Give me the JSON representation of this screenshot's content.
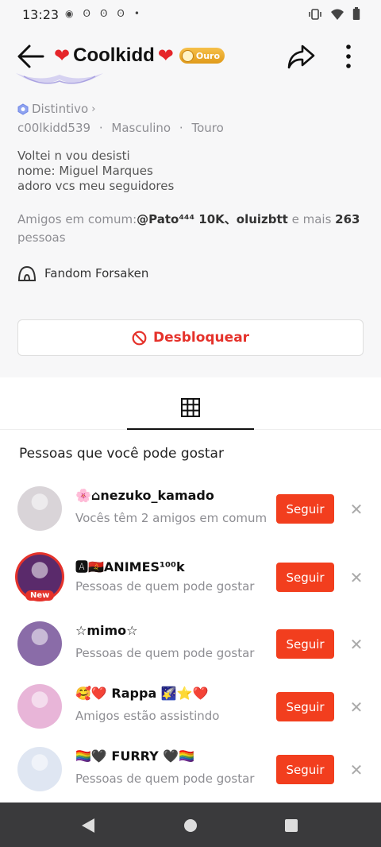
{
  "status": {
    "time": "13:23"
  },
  "header": {
    "title": "Coolkidd",
    "badge": "Ouro"
  },
  "profile": {
    "badge_label": "Distintivo",
    "username": "c00lkidd539",
    "gender": "Masculino",
    "sign": "Touro",
    "separator": "·",
    "bio": [
      "Voltei n vou desisti",
      "nome: Miguel Marques",
      "adoro vcs meu seguidores"
    ],
    "mutual_prefix": "Amigos em comum:",
    "mutual_names": "@Pato⁴⁴⁴   10K、oluizbtt",
    "mutual_middle": " e mais ",
    "mutual_count": "263",
    "mutual_suffix": " pessoas",
    "fandom": "Fandom Forsaken",
    "unblock_label": "Desbloquear"
  },
  "suggestions": {
    "title": "Pessoas que você pode gostar",
    "follow_label": "Seguir",
    "close_symbol": "✕",
    "items": [
      {
        "name": "🌸⌂nezuko_kamado",
        "subtitle": "Vocês têm 2 amigos em comum",
        "avatar_color": "#d9d4d8",
        "new": false
      },
      {
        "name": "🅰🇦🇴ANIMES¹⁰⁰k",
        "subtitle": "Pessoas de quem pode gostar",
        "avatar_color": "#5a2a6b",
        "new": true,
        "new_label": "New"
      },
      {
        "name": "☆mimo☆",
        "subtitle": "Pessoas de quem pode gostar",
        "avatar_color": "#8a6ca8",
        "new": false
      },
      {
        "name": "🥰❤️ Rappa 🌠⭐❤️",
        "subtitle": "Amigos estão assistindo",
        "avatar_color": "#e8b5d8",
        "new": false
      },
      {
        "name": "🏳️‍🌈🖤 FURRY 🖤🏳️‍🌈",
        "subtitle": "Pessoas de quem pode gostar",
        "avatar_color": "#dfe6f2",
        "new": false
      }
    ]
  },
  "colors": {
    "accent": "#f23e1e",
    "unblock": "#e5322b",
    "gold": "#f0ad2e"
  }
}
